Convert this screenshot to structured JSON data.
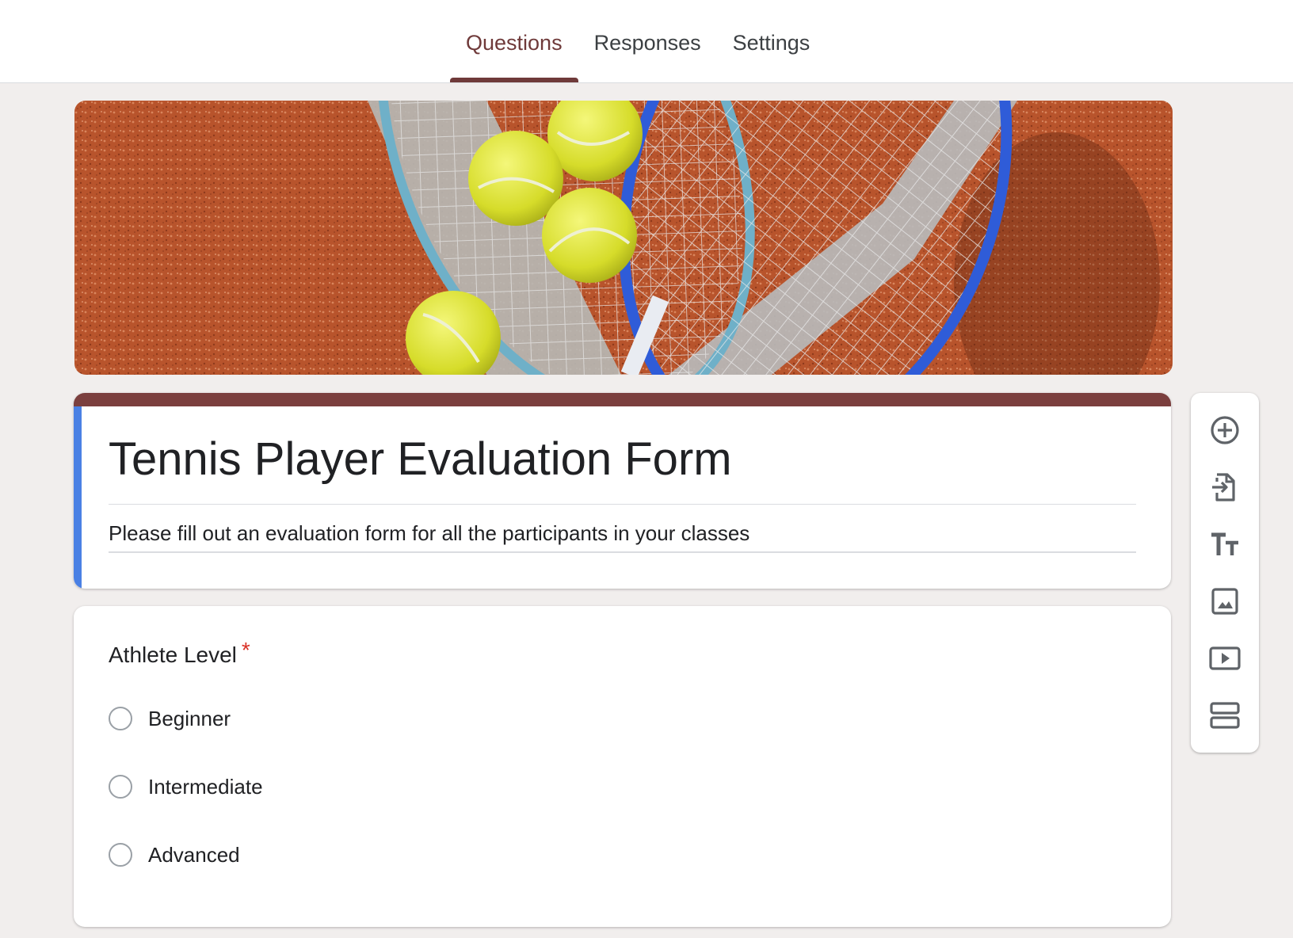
{
  "tabs": [
    {
      "label": "Questions",
      "active": true
    },
    {
      "label": "Responses",
      "active": false
    },
    {
      "label": "Settings",
      "active": false
    }
  ],
  "banner": {
    "icon": "tennis-banner-image"
  },
  "form": {
    "title": "Tennis Player Evaluation Form",
    "description": "Please fill out an evaluation form for all the participants in your classes"
  },
  "question": {
    "title": "Athlete Level",
    "required_mark": "*",
    "options": [
      "Beginner",
      "Intermediate",
      "Advanced"
    ]
  },
  "toolbar": {
    "tools": [
      "add-question-icon",
      "import-questions-icon",
      "add-title-icon",
      "add-image-icon",
      "add-video-icon",
      "add-section-icon"
    ]
  },
  "colors": {
    "accent": "#6f3a3a",
    "title_strip": "#7b3f3e",
    "focus_strip": "#4a80e4",
    "required": "#d93025"
  }
}
